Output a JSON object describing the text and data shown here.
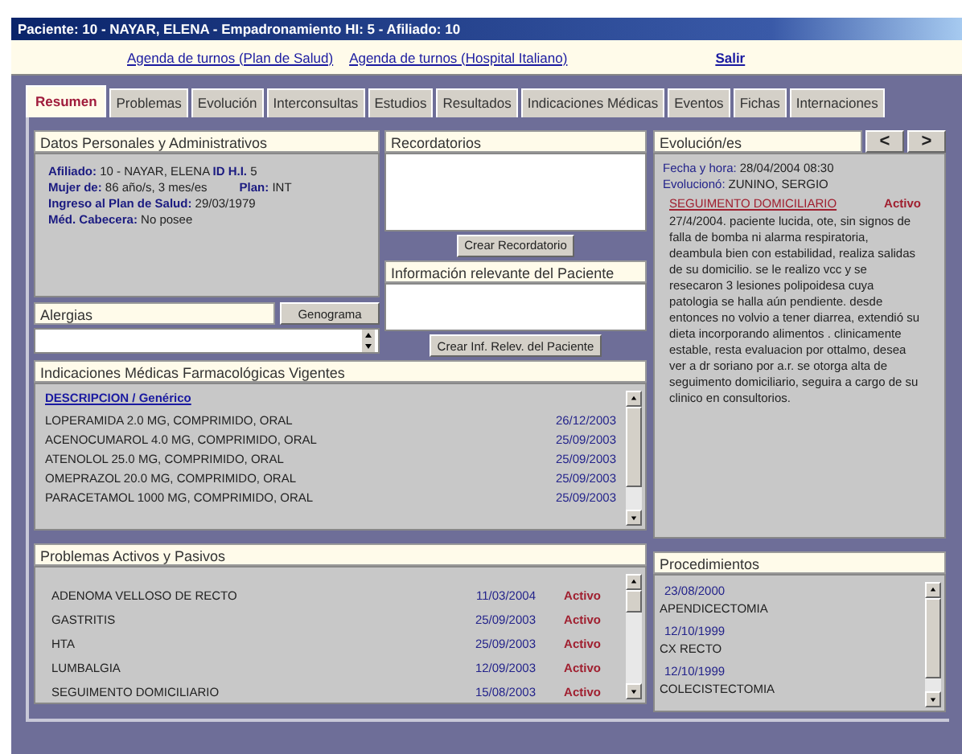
{
  "window": {
    "title": "Paciente: 10 - NAYAR, ELENA - Empadronamiento HI: 5 - Afiliado: 10"
  },
  "links": [
    {
      "label": "Agenda de turnos (Plan de Salud)",
      "kind": "normal"
    },
    {
      "label": "Agenda de turnos (Hospital Italiano)",
      "kind": "normal"
    },
    {
      "label": "Salir",
      "kind": "strong"
    }
  ],
  "tabs": [
    {
      "label": "Resumen",
      "selected": true
    },
    {
      "label": "Problemas",
      "selected": false
    },
    {
      "label": "Evolución",
      "selected": false
    },
    {
      "label": "Interconsultas",
      "selected": false
    },
    {
      "label": "Estudios",
      "selected": false
    },
    {
      "label": "Resultados",
      "selected": false
    },
    {
      "label": "Indicaciones Médicas",
      "selected": false
    },
    {
      "label": "Eventos",
      "selected": false
    },
    {
      "label": "Fichas",
      "selected": false
    },
    {
      "label": "Internaciones",
      "selected": false
    }
  ],
  "datos": {
    "title": "Datos Personales y Administrativos",
    "lines": [
      [
        "**Afiliado:** 10 - NAYAR, ELENA **ID H.I.** 5"
      ],
      [
        "**Mujer de:**   86 año/s, 3 mes/es",
        "**Plan:** INT"
      ],
      [
        "**Ingreso al Plan de Salud:**   29/03/1979"
      ],
      [
        "**Méd. Cabecera:** No posee"
      ]
    ]
  },
  "alergias": {
    "title": "Alergias",
    "button": "Genograma"
  },
  "recordatorios": {
    "title": "Recordatorios",
    "button": "Crear Recordatorio"
  },
  "info": {
    "title": "Información relevante del Paciente",
    "button": "Crear Inf. Relev. del Paciente"
  },
  "indicaciones": {
    "title": "Indicaciones Médicas Farmacológicas Vigentes",
    "header": "DESCRIPCION / Genérico",
    "rows": [
      {
        "name": "LOPERAMIDA 2.0 MG, COMPRIMIDO, ORAL",
        "date": "26/12/2003"
      },
      {
        "name": "ACENOCUMAROL 4.0 MG, COMPRIMIDO, ORAL",
        "date": "25/09/2003"
      },
      {
        "name": "ATENOLOL 25.0 MG, COMPRIMIDO, ORAL",
        "date": "25/09/2003"
      },
      {
        "name": "OMEPRAZOL 20.0 MG, COMPRIMIDO, ORAL",
        "date": "25/09/2003"
      },
      {
        "name": "PARACETAMOL 1000 MG, COMPRIMIDO, ORAL",
        "date": "25/09/2003"
      }
    ]
  },
  "problemas": {
    "title": "Problemas Activos y Pasivos",
    "rows": [
      {
        "name": "ADENOMA VELLOSO DE RECTO",
        "date": "11/03/2004",
        "status": "Activo"
      },
      {
        "name": "GASTRITIS",
        "date": "25/09/2003",
        "status": "Activo"
      },
      {
        "name": "HTA",
        "date": "25/09/2003",
        "status": "Activo"
      },
      {
        "name": "LUMBALGIA",
        "date": "12/09/2003",
        "status": "Activo"
      },
      {
        "name": "SEGUIMENTO DOMICILIARIO",
        "date": "15/08/2003",
        "status": "Activo"
      }
    ]
  },
  "evolucion": {
    "title": "Evolución/es",
    "prev": "<",
    "next": ">",
    "fecha_label": "Fecha y hora:",
    "fecha": "28/04/2004  08:30",
    "autor_label": "Evolucionó:",
    "autor": "ZUNINO, SERGIO",
    "problema": "SEGUIMENTO DOMICILIARIO",
    "estado": "Activo",
    "texto": "27/4/2004. paciente lucida, ote, sin signos de falla de bomba ni alarma respiratoria, deambula  bien con estabilidad, realiza salidas de su domicilio. se le realizo vcc y se resecaron 3  lesiones polipoidesa cuya patologia se halla aún pendiente. desde entonces no volvio a tener diarrea, extendió su dieta incorporando alimentos . clinicamente estable, resta evaluacion por ottalmo, desea ver a dr soriano por a.r. se otorga alta de seguimento domiciliario, seguira a cargo de su clinico en consultorios."
  },
  "procedimientos": {
    "title": "Procedimientos",
    "rows": [
      {
        "date": "23/08/2000",
        "name": "APENDICECTOMIA"
      },
      {
        "date": "12/10/1999",
        "name": "CX RECTO"
      },
      {
        "date": "12/10/1999",
        "name": "COLECISTECTOMIA"
      }
    ]
  }
}
